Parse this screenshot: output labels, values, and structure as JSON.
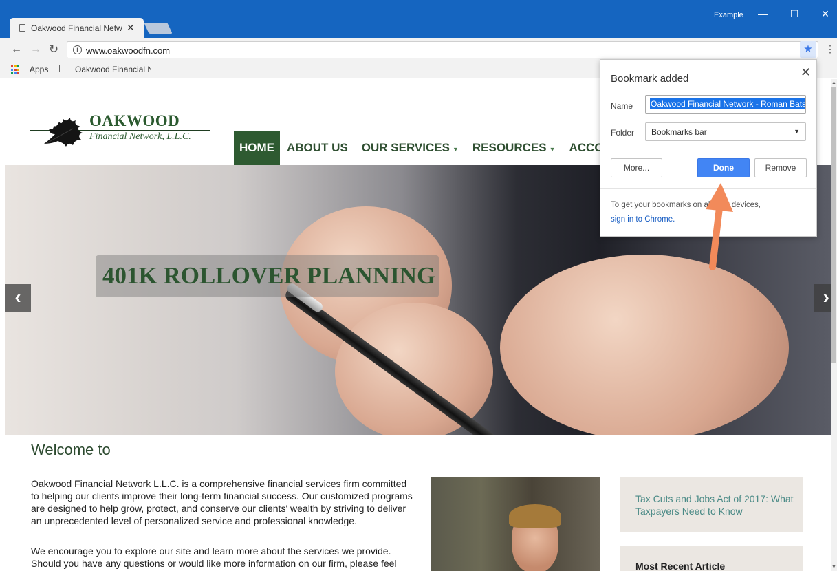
{
  "browser": {
    "tab_title": "Oakwood Financial Netw",
    "profile_name": "Example",
    "url": "www.oakwoodfn.com",
    "bookmarks_bar": {
      "apps_label": "Apps",
      "item_label": "Oakwood Financial N"
    }
  },
  "site": {
    "logo_name": "OAKWOOD",
    "logo_sub": "Financial Network, L.L.C.",
    "nav": {
      "home": "HOME",
      "about": "ABOUT US",
      "services": "OUR SERVICES",
      "resources": "RESOURCES",
      "accounts": "ACCOU"
    },
    "hero_caption": "401K ROLLOVER PLANNING",
    "welcome_heading": "Welcome to",
    "intro_paragraph": "Oakwood Financial Network L.L.C. is a comprehensive financial services firm committed to helping our clients improve their long-term financial success. Our customized programs are designed to help grow, protect, and conserve our clients' wealth by striving to deliver an unprecedented level of personalized service and professional knowledge.",
    "second_paragraph": "We encourage you to explore our site and learn more about the services we provide. Should you have any questions or would like more information on our firm, please feel",
    "sidebar_article": "Tax Cuts and Jobs Act of 2017: What Taxpayers Need to Know",
    "sidebar_recent": "Most Recent Article"
  },
  "bookmark_popup": {
    "title": "Bookmark added",
    "name_label": "Name",
    "name_value": "Oakwood Financial Network - Roman Bats",
    "folder_label": "Folder",
    "folder_value": "Bookmarks bar",
    "more_button": "More...",
    "done_button": "Done",
    "remove_button": "Remove",
    "sync_text": "To get your bookmarks on all your devices,",
    "sync_link": "sign in to Chrome."
  },
  "colors": {
    "chrome_blue": "#1565c0",
    "site_green": "#2e5a31",
    "done_blue": "#4285f4",
    "annotation_arrow": "#f28a5a"
  }
}
